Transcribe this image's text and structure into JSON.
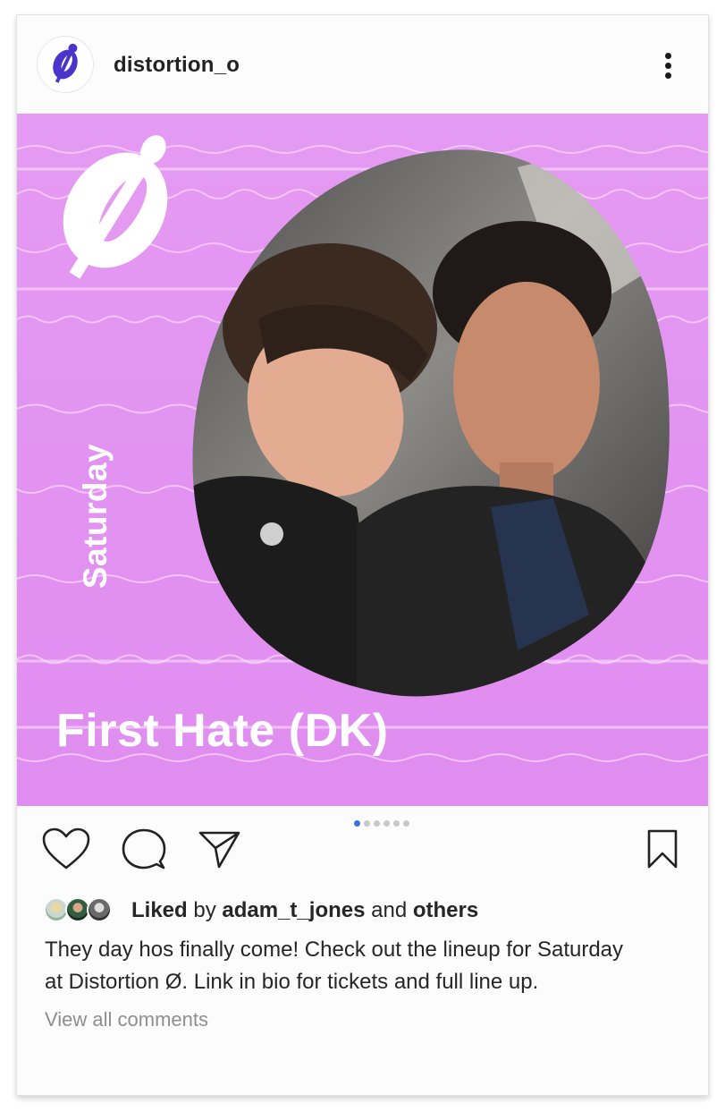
{
  "post": {
    "username": "distortion_o",
    "more_icon": "more-vertical-icon",
    "media": {
      "day": "Saturday",
      "artist": "First Hate (DK)",
      "background_color": "#e59af2",
      "logo_icon": "distortion-logo-icon",
      "photo_description_icon": "band-photo",
      "carousel": {
        "total": 6,
        "active_index": 1
      }
    },
    "actions": {
      "like_icon": "heart-icon",
      "comment_icon": "comment-icon",
      "share_icon": "paper-plane-icon",
      "save_icon": "bookmark-icon"
    },
    "likes": {
      "prefix": "Liked",
      "by": "by",
      "user": "adam_t_jones",
      "and": "and",
      "others": "others"
    },
    "caption_line1": "They day hos finally come! Check out the lineup for Saturday",
    "caption_line2": "at Distortion Ø. Link in bio for tickets and full line up.",
    "view_comments": "View all comments"
  }
}
